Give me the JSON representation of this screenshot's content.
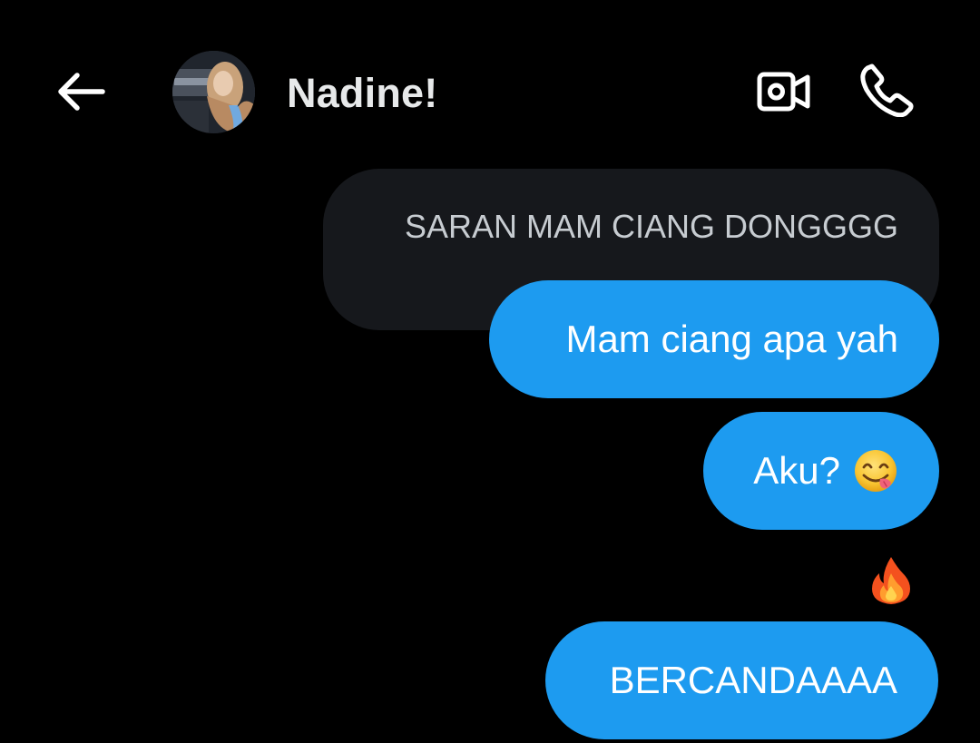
{
  "header": {
    "contact_name": "Nadine!",
    "back_icon": "arrow-left-icon",
    "video_icon": "video-call-icon",
    "call_icon": "phone-icon"
  },
  "messages": [
    {
      "type": "quoted",
      "text": "SARAN MAM CIANG DONGGGG"
    },
    {
      "type": "sent",
      "text": "Mam ciang apa yah"
    },
    {
      "type": "sent",
      "text": "Aku?",
      "emoji": "face-savoring-food-emoji"
    },
    {
      "type": "reaction",
      "emoji": "fire-emoji"
    },
    {
      "type": "sent",
      "text": "BERCANDAAAA"
    }
  ],
  "colors": {
    "background": "#000000",
    "sent_bubble": "#1d9bf0",
    "quoted_bubble": "#16181c",
    "header_text": "#e7e9ea",
    "quoted_text": "#c7ccd1"
  }
}
